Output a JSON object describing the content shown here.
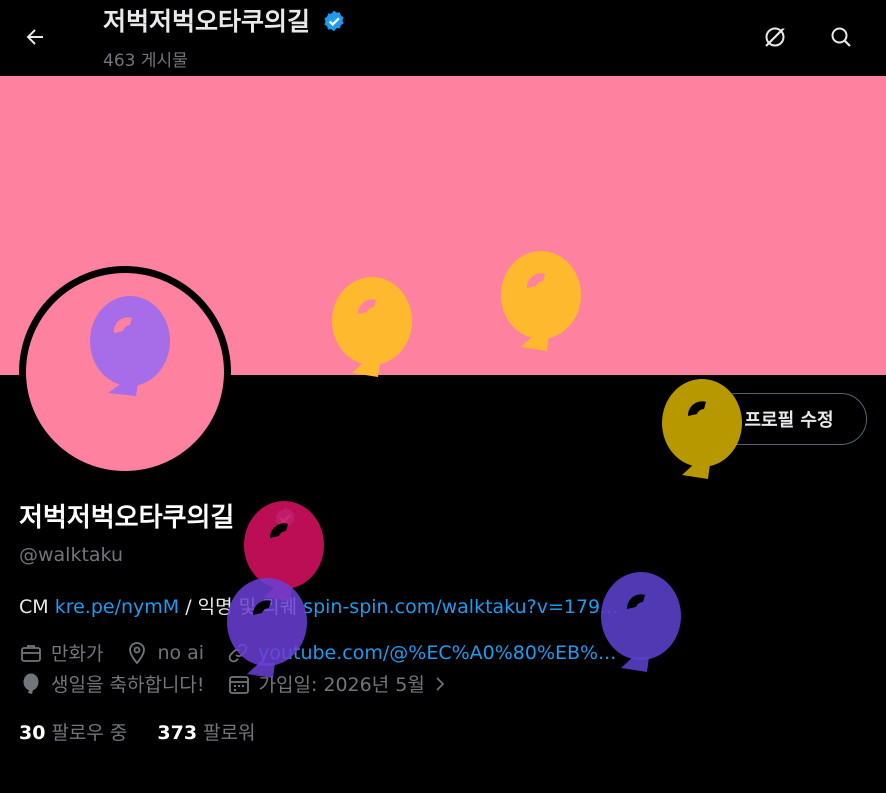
{
  "header": {
    "title": "저벅저벅오타쿠의길",
    "post_count": "463 게시물"
  },
  "profile": {
    "edit_label": "프로필 수정",
    "display_name": "저벅저벅오타쿠의길",
    "handle": "@walktaku",
    "bio": {
      "text1": "CM ",
      "link1": "kre.pe/nymM",
      "text2": " / 익명 및 리퀘 ",
      "link2": "spin-spin.com/walktaku?v=179..."
    },
    "meta": {
      "job": "만화가",
      "location": "no ai",
      "url": "youtube.com/@%EC%A0%80%EB%...",
      "birthday": "생일을 축하합니다!",
      "joined": "가입일: 2026년 5월"
    },
    "following_count": "30",
    "following_label": "팔로우 중",
    "followers_count": "373",
    "followers_label": "팔로워"
  },
  "colors": {
    "banner": "#fe819f",
    "link": "#1d9bf0",
    "verified": "#1d9bf0"
  }
}
